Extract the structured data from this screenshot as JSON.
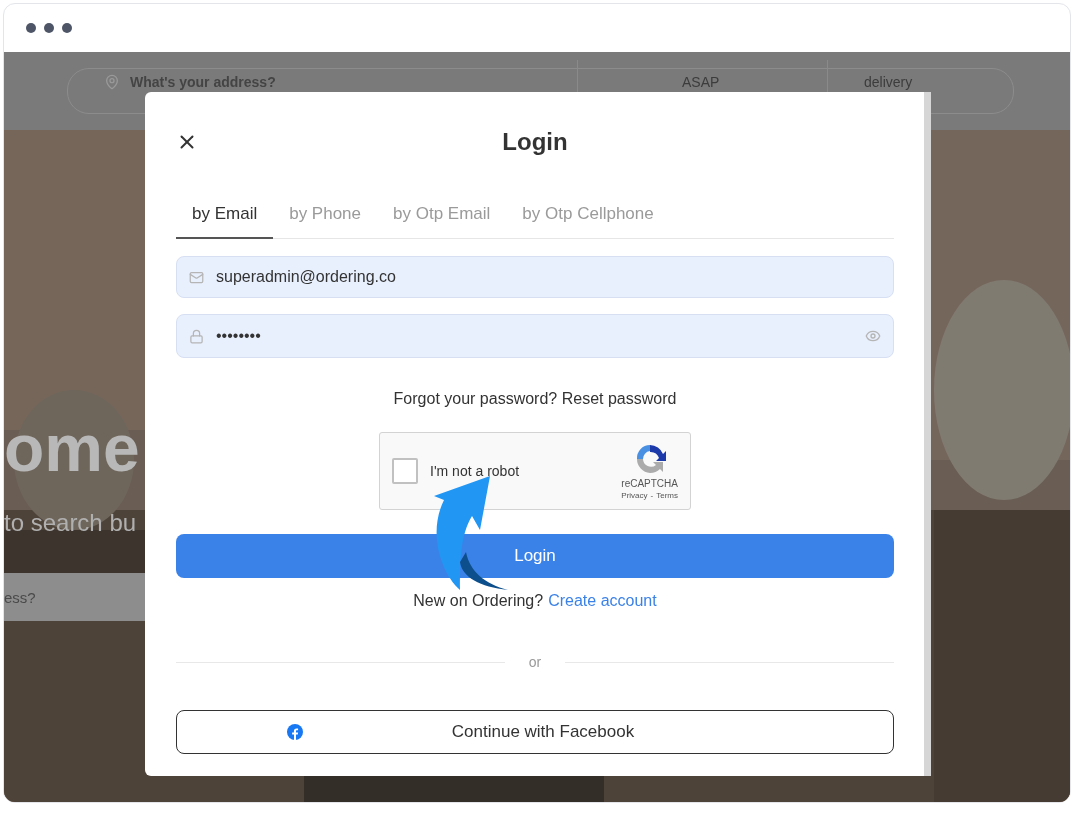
{
  "background": {
    "address_placeholder": "What's your address?",
    "time": "ASAP",
    "mode": "delivery",
    "hero_title": "ome",
    "hero_subtitle": "to search bu",
    "hero_search_placeholder": "ess?"
  },
  "modal": {
    "title": "Login",
    "tabs": [
      {
        "label": "by Email",
        "selected": true
      },
      {
        "label": "by Phone",
        "selected": false
      },
      {
        "label": "by Otp Email",
        "selected": false
      },
      {
        "label": "by Otp Cellphone",
        "selected": false
      }
    ],
    "email": {
      "value": "superadmin@ordering.co"
    },
    "password": {
      "value": "••••••••"
    },
    "forgot": "Forgot your password? Reset password",
    "captcha": {
      "label": "I'm not a robot",
      "checked": false,
      "brand": "reCAPTCHA",
      "privacy": "Privacy",
      "separator": "-",
      "terms": "Terms"
    },
    "login_button": "Login",
    "signup": {
      "text": "New on Ordering?",
      "link": "Create account"
    },
    "divider": "or",
    "facebook_button": "Continue with Facebook"
  }
}
